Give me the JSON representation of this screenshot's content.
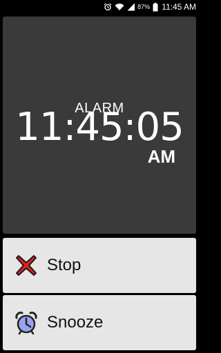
{
  "status_bar": {
    "battery_percent": "87%",
    "time": "11:45 AM",
    "icons": [
      "alarm-clock-icon",
      "wifi-icon",
      "signal-icon",
      "battery-icon"
    ],
    "color": "#ffffff"
  },
  "alarm": {
    "title": "ALARM",
    "time": "11:45:05",
    "meridiem": "AM"
  },
  "actions": {
    "stop_label": "Stop",
    "stop_icon": "close-x-icon",
    "stop_icon_color": "#e02020",
    "snooze_label": "Snooze",
    "snooze_icon": "alarm-clock-icon",
    "snooze_icon_color": "#9aa4ec"
  },
  "colors": {
    "background": "#000000",
    "panel": "#3a3a3a",
    "button": "#e6e6e6"
  }
}
